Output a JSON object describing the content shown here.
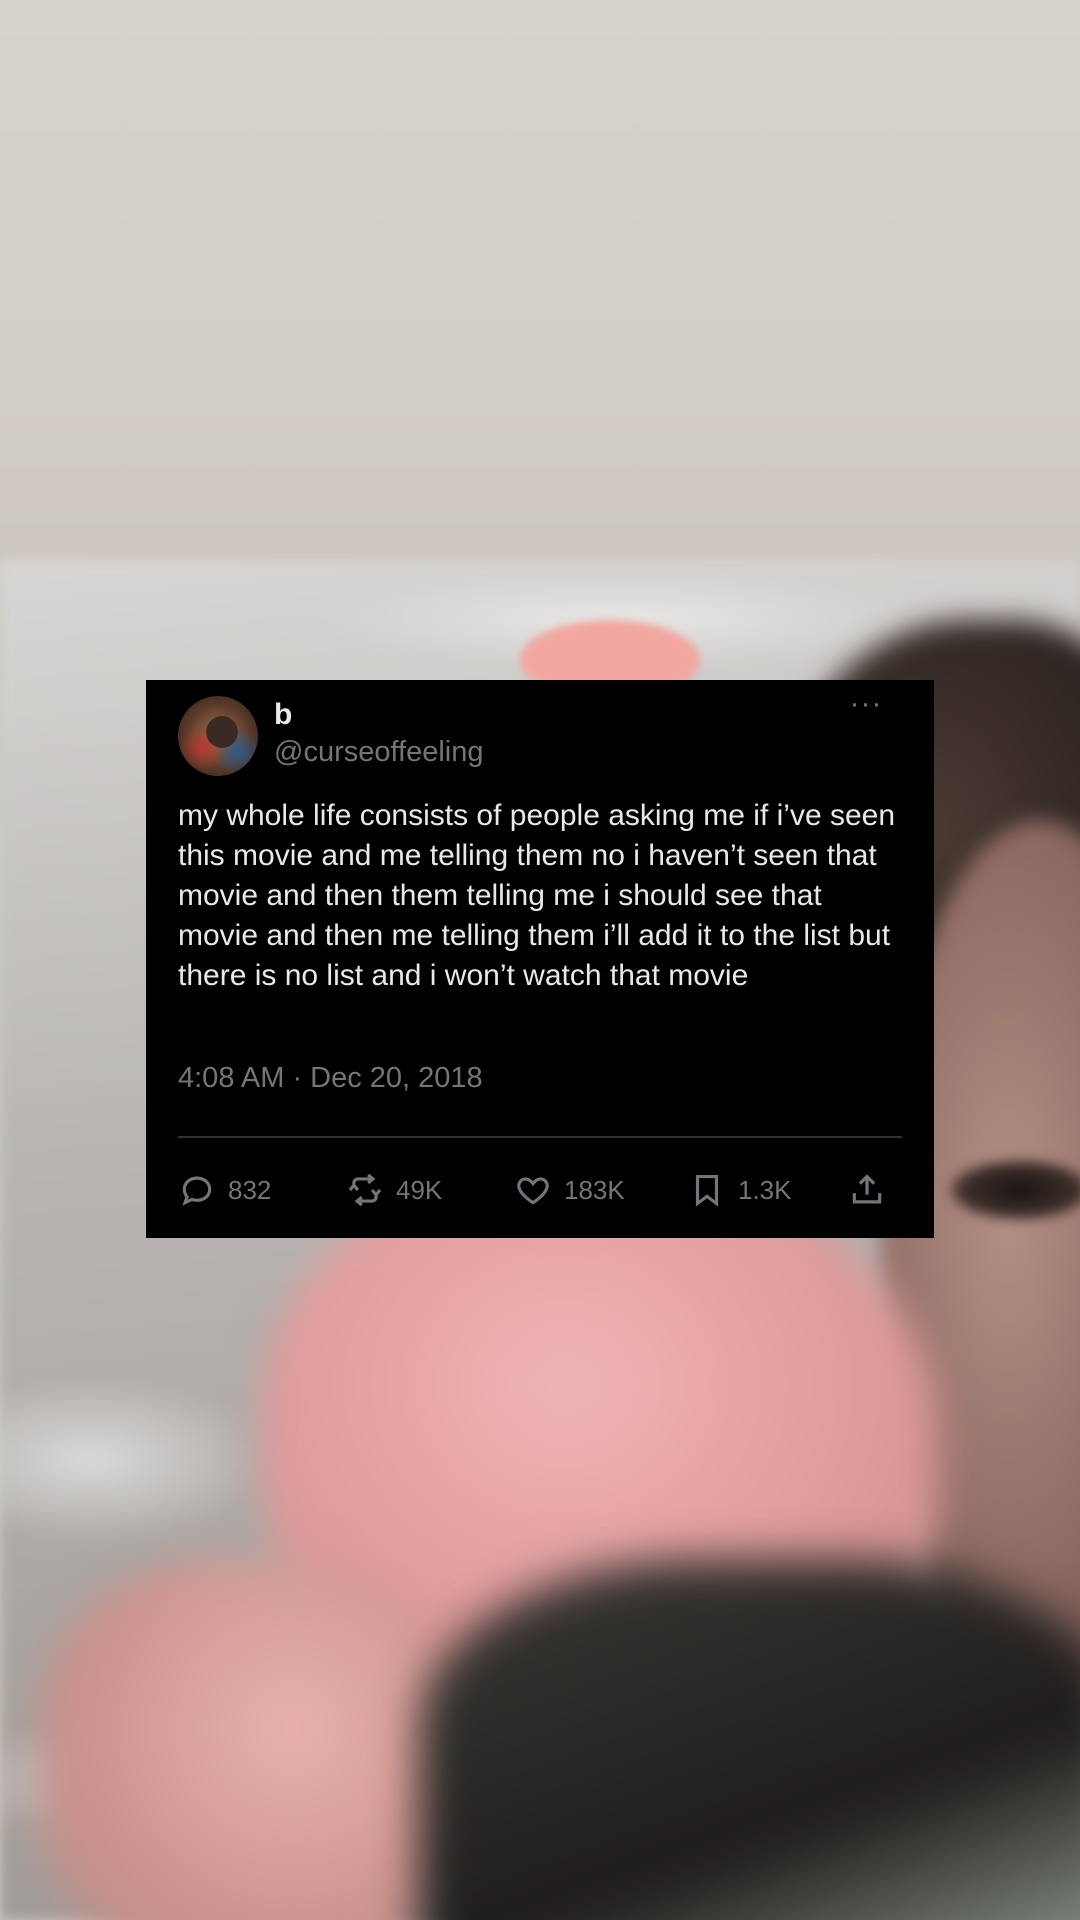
{
  "tweet": {
    "name": "b",
    "handle": "@curseoffeeling",
    "text": "my whole life consists of people asking me if i’ve seen this movie and me telling them no i haven’t seen that movie and then them telling me i should see that movie and then me telling them i’ll add it to the list but there is no list and i won’t watch that movie",
    "timestamp": "4:08 AM · Dec 20, 2018",
    "more_icon": "ellipsis-icon",
    "more_label": "···",
    "stats": {
      "replies": "832",
      "reposts": "49K",
      "likes": "183K",
      "bookmarks": "1.3K"
    }
  },
  "colors": {
    "card_bg": "#000000",
    "text": "#e7e9ea",
    "muted": "#71767b",
    "divider": "#2f3336"
  }
}
